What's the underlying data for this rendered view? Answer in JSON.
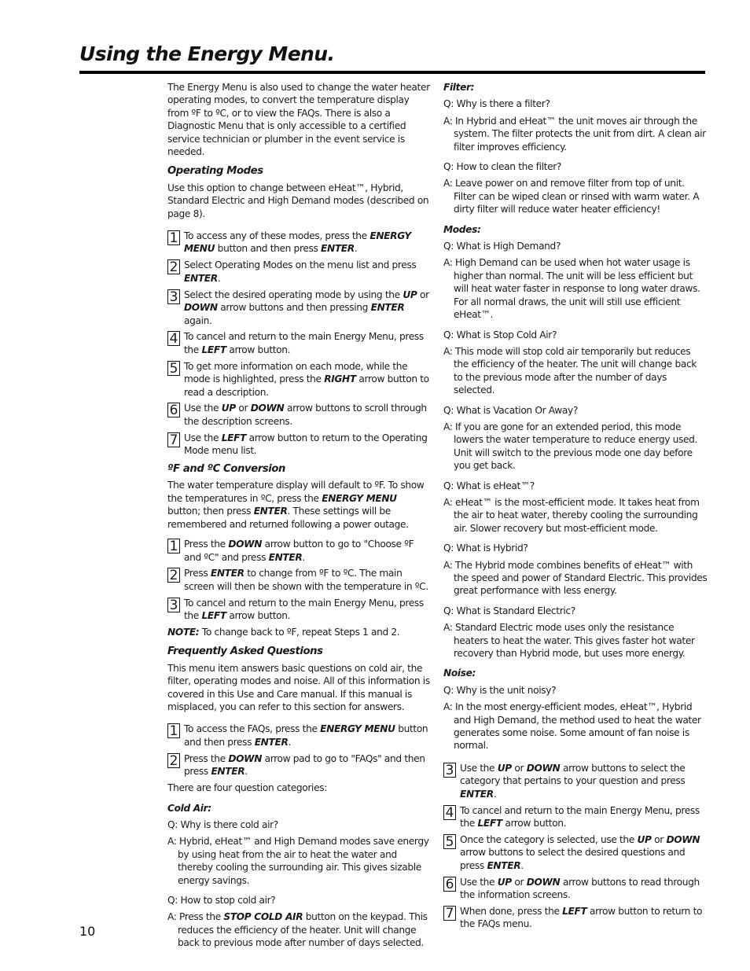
{
  "page": {
    "title": "Using the Energy Menu.",
    "page_number": "10"
  },
  "intro": "The Energy Menu is also used to change the water heater operating modes, to convert the temperature display from ºF to ºC, or to view the FAQs. There is also a Diagnostic Menu that is only accessible to a certified service technician or plumber in the event service is needed.",
  "operating_modes": {
    "heading": "Operating Modes",
    "description": "Use this option to change between eHeat™, Hybrid, Standard Electric and High Demand modes (described on page 8).",
    "steps": [
      {
        "num": "1",
        "parts": [
          [
            "To access any of these modes, press the ",
            false
          ],
          [
            "ENERGY MENU",
            true
          ],
          [
            " button and then press ",
            false
          ],
          [
            "ENTER",
            true
          ],
          [
            ".",
            false
          ]
        ]
      },
      {
        "num": "2",
        "parts": [
          [
            "Select Operating Modes on the menu list and press ",
            false
          ],
          [
            "ENTER",
            true
          ],
          [
            ".",
            false
          ]
        ]
      },
      {
        "num": "3",
        "parts": [
          [
            "Select the desired operating mode by using the ",
            false
          ],
          [
            "UP",
            true
          ],
          [
            " or ",
            false
          ],
          [
            "DOWN",
            true
          ],
          [
            " arrow buttons and then pressing ",
            false
          ],
          [
            "ENTER",
            true
          ],
          [
            " again.",
            false
          ]
        ]
      },
      {
        "num": "4",
        "parts": [
          [
            "To cancel and return to the main Energy Menu, press the ",
            false
          ],
          [
            "LEFT",
            true
          ],
          [
            " arrow button.",
            false
          ]
        ]
      },
      {
        "num": "5",
        "parts": [
          [
            "To get more information on each mode, while the mode is highlighted, press the ",
            false
          ],
          [
            "RIGHT",
            true
          ],
          [
            " arrow button to read a description.",
            false
          ]
        ]
      },
      {
        "num": "6",
        "parts": [
          [
            "Use the ",
            false
          ],
          [
            "UP",
            true
          ],
          [
            " or ",
            false
          ],
          [
            "DOWN",
            true
          ],
          [
            " arrow buttons to scroll through the description screens.",
            false
          ]
        ]
      },
      {
        "num": "7",
        "parts": [
          [
            "Use the ",
            false
          ],
          [
            "LEFT",
            true
          ],
          [
            " arrow button to return to the Operating Mode menu list.",
            false
          ]
        ]
      }
    ]
  },
  "conversion": {
    "heading": "ºF and ºC Conversion",
    "description_parts": [
      [
        "The water temperature display will default to ºF. To show the temperatures in ºC, press the ",
        false
      ],
      [
        "ENERGY MENU",
        true
      ],
      [
        " button; then press ",
        false
      ],
      [
        "ENTER",
        true
      ],
      [
        ". These settings will be remembered and returned following a power outage.",
        false
      ]
    ],
    "steps": [
      {
        "num": "1",
        "parts": [
          [
            "Press the ",
            false
          ],
          [
            "DOWN",
            true
          ],
          [
            " arrow button to go to \"Choose ºF and ºC\" and press ",
            false
          ],
          [
            "ENTER",
            true
          ],
          [
            ".",
            false
          ]
        ]
      },
      {
        "num": "2",
        "parts": [
          [
            "Press ",
            false
          ],
          [
            "ENTER",
            true
          ],
          [
            " to change from ºF to ºC. The main screen will then be shown with the temperature in ºC.",
            false
          ]
        ]
      },
      {
        "num": "3",
        "parts": [
          [
            "To cancel and return to the main Energy Menu, press the ",
            false
          ],
          [
            "LEFT",
            true
          ],
          [
            " arrow button.",
            false
          ]
        ]
      }
    ],
    "note_label": "NOTE:",
    "note_text": " To change back to ºF, repeat Steps 1 and 2."
  },
  "faq": {
    "heading": "Frequently Asked Questions",
    "description": "This menu item answers basic questions on cold air, the filter, operating modes and noise. All of this information is covered in this Use and Care manual. If this manual is misplaced, you can refer to this section for answers.",
    "steps_a": [
      {
        "num": "1",
        "parts": [
          [
            "To access the FAQs, press the ",
            false
          ],
          [
            "ENERGY MENU",
            true
          ],
          [
            " button and then press ",
            false
          ],
          [
            "ENTER",
            true
          ],
          [
            ".",
            false
          ]
        ]
      },
      {
        "num": "2",
        "parts": [
          [
            "Press the ",
            false
          ],
          [
            "DOWN",
            true
          ],
          [
            " arrow pad to go to \"FAQs\" and then press ",
            false
          ],
          [
            "ENTER",
            true
          ],
          [
            ".",
            false
          ]
        ]
      }
    ],
    "categories_intro": "There are four question categories:",
    "categories": [
      {
        "name": "Cold Air:",
        "qa": [
          {
            "q": "Q: Why is there cold air?",
            "a_parts": [
              [
                "A: Hybrid, eHeat™ and High Demand modes save energy by using heat from the air to heat the water and thereby cooling the surrounding air. This gives sizable energy savings.",
                false
              ]
            ]
          },
          {
            "q": "Q: How to stop cold air?",
            "a_parts": [
              [
                "A: Press the ",
                false
              ],
              [
                "STOP COLD AIR",
                true
              ],
              [
                " button on the keypad. This reduces the efficiency of the heater. Unit will change back to previous mode after number of days selected.",
                false
              ]
            ]
          }
        ]
      },
      {
        "name": "Filter:",
        "qa": [
          {
            "q": "Q: Why is there a filter?",
            "a_parts": [
              [
                "A: In Hybrid and eHeat™ the unit moves air through the system. The filter protects the unit from dirt. A clean air filter improves efficiency.",
                false
              ]
            ]
          },
          {
            "q": "Q: How to clean the filter?",
            "a_parts": [
              [
                "A: Leave power on and remove filter from top of unit. Filter can be wiped clean or rinsed with warm water. A dirty filter will reduce water heater efficiency!",
                false
              ]
            ]
          }
        ]
      },
      {
        "name": "Modes:",
        "qa": [
          {
            "q": "Q: What is High Demand?",
            "a_parts": [
              [
                "A: High Demand can be used when hot water usage is higher than normal. The unit will be less efficient but will heat water faster in response to long water draws. For all normal draws, the unit will still use efficient eHeat™.",
                false
              ]
            ]
          },
          {
            "q": "Q: What is Stop Cold Air?",
            "a_parts": [
              [
                "A: This mode will stop cold air temporarily but reduces the efficiency of the heater. The unit will change back to the previous mode after the number of days selected.",
                false
              ]
            ]
          },
          {
            "q": "Q: What is Vacation Or Away?",
            "a_parts": [
              [
                "A: If you are gone for an extended period, this mode lowers the water temperature to reduce energy used. Unit will switch to the previous mode one day before you get back.",
                false
              ]
            ]
          },
          {
            "q": "Q: What is eHeat™?",
            "a_parts": [
              [
                "A: eHeat™ is the most-efficient mode. It takes heat from the air to heat water, thereby cooling the surrounding air. Slower recovery but most-efficient mode.",
                false
              ]
            ]
          },
          {
            "q": "Q: What is Hybrid?",
            "a_parts": [
              [
                "A: The Hybrid mode combines benefits of eHeat™ with the speed and power of Standard Electric. This provides great performance with less energy.",
                false
              ]
            ]
          },
          {
            "q": "Q: What is Standard Electric?",
            "a_parts": [
              [
                "A: Standard Electric mode uses only the resistance heaters to heat the water. This gives faster hot water recovery than Hybrid mode, but uses more energy.",
                false
              ]
            ]
          }
        ]
      },
      {
        "name": "Noise:",
        "qa": [
          {
            "q": "Q: Why is the unit noisy?",
            "a_parts": [
              [
                "A: In the most energy-efficient modes, eHeat™, Hybrid and High Demand, the method used to heat the water generates some noise. Some amount of fan noise is normal.",
                false
              ]
            ]
          }
        ]
      }
    ],
    "steps_b": [
      {
        "num": "3",
        "parts": [
          [
            "Use the ",
            false
          ],
          [
            "UP",
            true
          ],
          [
            " or ",
            false
          ],
          [
            "DOWN",
            true
          ],
          [
            " arrow buttons to select the category that pertains to your question and press ",
            false
          ],
          [
            "ENTER",
            true
          ],
          [
            ".",
            false
          ]
        ]
      },
      {
        "num": "4",
        "parts": [
          [
            "To cancel and return to the main Energy Menu, press the ",
            false
          ],
          [
            "LEFT",
            true
          ],
          [
            " arrow button.",
            false
          ]
        ]
      },
      {
        "num": "5",
        "parts": [
          [
            "Once the category is selected, use the ",
            false
          ],
          [
            "UP",
            true
          ],
          [
            " or ",
            false
          ],
          [
            "DOWN",
            true
          ],
          [
            " arrow buttons to select the desired questions and press ",
            false
          ],
          [
            "ENTER",
            true
          ],
          [
            ".",
            false
          ]
        ]
      },
      {
        "num": "6",
        "parts": [
          [
            "Use the ",
            false
          ],
          [
            "UP",
            true
          ],
          [
            " or ",
            false
          ],
          [
            "DOWN",
            true
          ],
          [
            " arrow buttons to read through the information screens.",
            false
          ]
        ]
      },
      {
        "num": "7",
        "parts": [
          [
            "When done, press the ",
            false
          ],
          [
            "LEFT",
            true
          ],
          [
            " arrow button to return to the FAQs menu.",
            false
          ]
        ]
      }
    ]
  }
}
